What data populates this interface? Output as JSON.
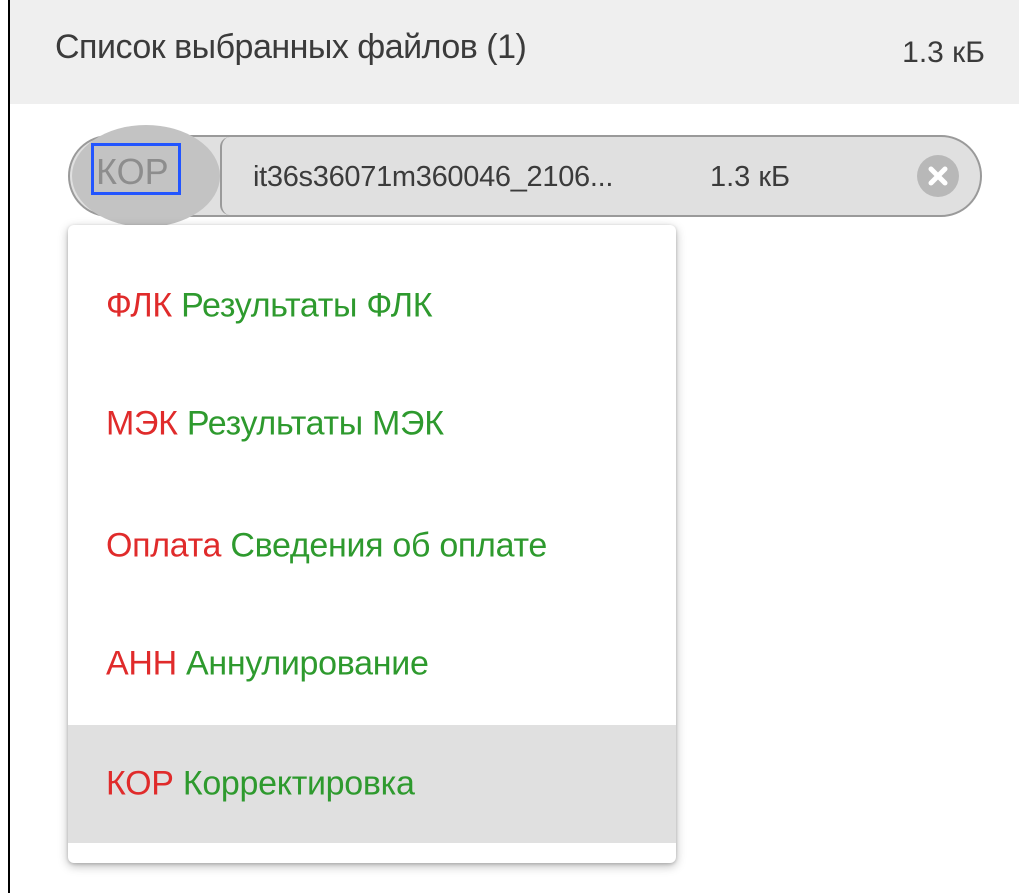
{
  "header": {
    "title": "Список выбранных файлов (1)",
    "total_size": "1.3 кБ"
  },
  "file": {
    "type_code": "КОР",
    "name": "it36s36071m360046_2106...",
    "size": "1.3 кБ",
    "remove_icon": "close-circle-icon"
  },
  "dropdown": {
    "options": [
      {
        "code": "ФЛК",
        "description": "Результаты ФЛК",
        "selected": false
      },
      {
        "code": "МЭК",
        "description": "Результаты МЭК",
        "selected": false
      },
      {
        "code": "Оплата",
        "description": "Сведения об оплате",
        "selected": false
      },
      {
        "code": "АНН",
        "description": "Аннулирование",
        "selected": false
      },
      {
        "code": "КОР",
        "description": "Корректировка",
        "selected": true
      }
    ]
  },
  "colors": {
    "code_color": "#e02b2b",
    "description_color": "#2e9a2e",
    "focus_outline": "#2255ff",
    "selected_bg": "#e0e0e0"
  }
}
